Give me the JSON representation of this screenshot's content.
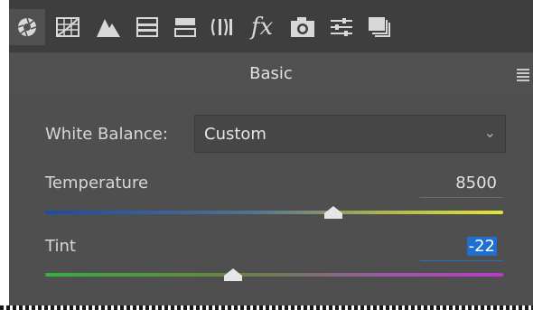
{
  "toolbar": {
    "tabs": [
      {
        "name": "basic-tab-icon"
      },
      {
        "name": "tone-curve-tab-icon"
      },
      {
        "name": "detail-tab-icon"
      },
      {
        "name": "hsl-tab-icon"
      },
      {
        "name": "split-toning-tab-icon"
      },
      {
        "name": "lens-corrections-tab-icon"
      },
      {
        "name": "effects-tab-icon"
      },
      {
        "name": "camera-calibration-tab-icon"
      },
      {
        "name": "presets-tab-icon"
      },
      {
        "name": "snapshots-tab-icon"
      }
    ],
    "effects_glyph": "fx"
  },
  "section": {
    "title": "Basic"
  },
  "white_balance": {
    "label": "White Balance:",
    "value": "Custom"
  },
  "temperature": {
    "label": "Temperature",
    "value": "8500",
    "fraction": 0.63
  },
  "tint": {
    "label": "Tint",
    "value": "-22",
    "fraction": 0.41
  },
  "colors": {
    "panel": "#4f4f4f",
    "toolbar": "#3e3e3e",
    "selection": "#1f6fd0"
  }
}
